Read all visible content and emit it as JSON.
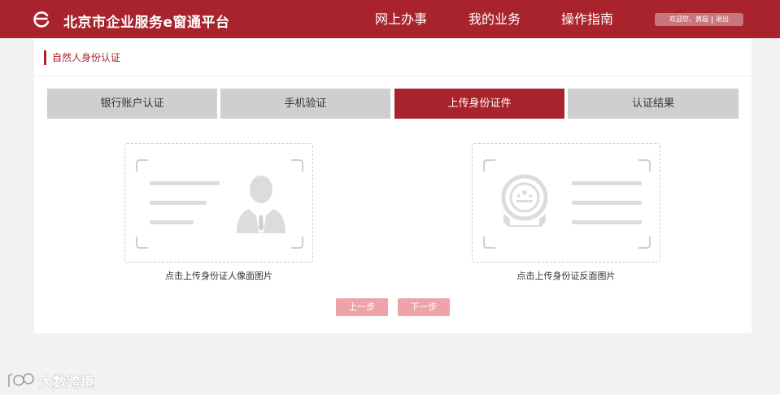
{
  "header": {
    "site_title": "北京市企业服务e窗通平台",
    "nav": [
      {
        "label": "网上办事"
      },
      {
        "label": "我的业务"
      },
      {
        "label": "操作指南"
      }
    ],
    "user": {
      "welcome": "欢迎您，黄超",
      "logout": "退出"
    }
  },
  "page": {
    "section_title": "自然人身份认证",
    "steps": [
      {
        "label": "银行账户认证",
        "active": false
      },
      {
        "label": "手机验证",
        "active": false
      },
      {
        "label": "上传身份证件",
        "active": true
      },
      {
        "label": "认证结果",
        "active": false
      }
    ],
    "uploads": {
      "front_caption": "点击上传身份证人像面图片",
      "back_caption": "点击上传身份证反面图片"
    },
    "buttons": {
      "prev": "上一步",
      "next": "下一步"
    }
  },
  "watermark": {
    "text": "大数跨境"
  },
  "colors": {
    "brand": "#a8232b",
    "tab_inactive": "#cfcfcf",
    "button_disabled": "#eda3a7"
  }
}
